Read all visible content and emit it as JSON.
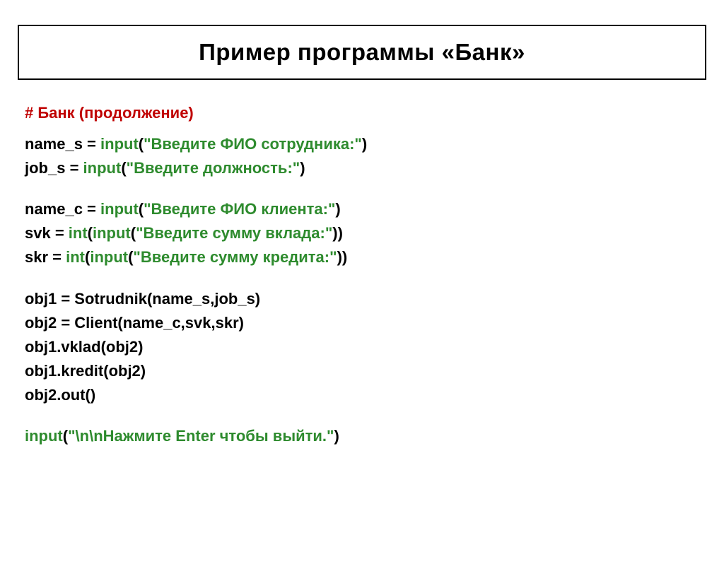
{
  "title": "Пример программы «Банк»",
  "comment": "# Банк (продолжение)",
  "code": {
    "l1a": "name_s = ",
    "l1b": "input",
    "l1c": "(",
    "l1d": "\"Введите ФИО сотрудника:\"",
    "l1e": ")",
    "l2a": "job_s  = ",
    "l2b": "input",
    "l2c": "(",
    "l2d": "\"Введите должность:\"",
    "l2e": ")",
    "l3a": "name_c = ",
    "l3b": "input",
    "l3c": "(",
    "l3d": "\"Введите ФИО клиента:\"",
    "l3e": ")",
    "l4a": "svk = ",
    "l4b": "int",
    "l4c": "(",
    "l4d": "input",
    "l4e": "(",
    "l4f": "\"Введите сумму вклада:\"",
    "l4g": "))",
    "l5a": "skr = ",
    "l5b": "int",
    "l5c": "(",
    "l5d": "input",
    "l5e": "(",
    "l5f": "\"Введите сумму кредита:\"",
    "l5g": "))",
    "l6": "obj1 = Sotrudnik(name_s,job_s)",
    "l7": "obj2 = Client(name_c,svk,skr)",
    "l8": "obj1.vklad(obj2)",
    "l9": "obj1.kredit(obj2)",
    "l10": "obj2.out()",
    "l11a": "input",
    "l11b": "(",
    "l11c": "\"\\n\\nНажмите Enter чтобы выйти.\"",
    "l11d": ")"
  }
}
